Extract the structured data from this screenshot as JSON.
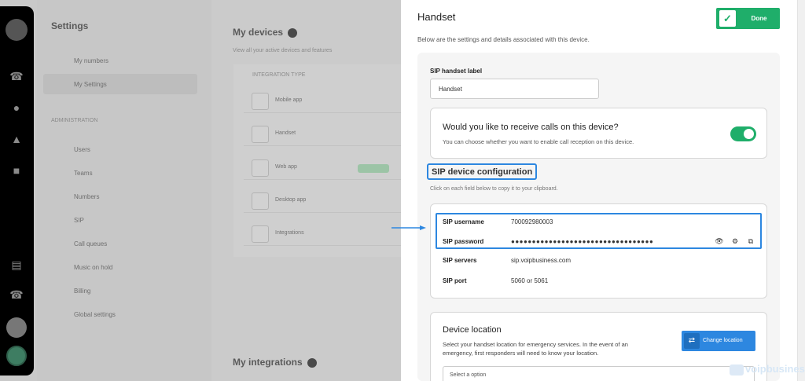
{
  "background": {
    "sidebar_title": "Settings",
    "nav_items": [
      "My numbers",
      "My Settings"
    ],
    "section_label": "ADMINISTRATION",
    "admin_items": [
      "Users",
      "Teams",
      "Numbers",
      "SIP",
      "Call queues",
      "Music on hold",
      "Billing",
      "Global settings"
    ],
    "devices_title": "My devices",
    "devices_sub": "View all your active devices and features",
    "devices_col": "INTEGRATION TYPE",
    "devices": [
      "Mobile app",
      "Handset",
      "Web app",
      "Desktop app",
      "Integrations"
    ],
    "integrations_title": "My integrations"
  },
  "drawer": {
    "title": "Handset",
    "done_label": "Done",
    "description": "Below are the settings and details associated with this device.",
    "label_field": {
      "label": "SIP handset label",
      "value": "Handset"
    },
    "receive_calls": {
      "question": "Would you like to receive calls on this device?",
      "description": "You can choose whether you want to enable call reception on this device.",
      "enabled": true
    },
    "config": {
      "title": "SIP device configuration",
      "hint": "Click on each field below to copy it to your clipboard.",
      "username_key": "SIP username",
      "username_value": "700092980003",
      "password_key": "SIP password",
      "password_value": "●●●●●●●●●●●●●●●●●●●●●●●●●●●●●●●●●●",
      "servers_key": "SIP servers",
      "servers_value": "sip.voipbusiness.com",
      "port_key": "SIP port",
      "port_value": "5060 or 5061"
    },
    "location": {
      "title": "Device location",
      "description": "Select your handset location for emergency services. In the event of an emergency, first responders will need to know your location.",
      "button_label": "Change location",
      "select_placeholder": "Select a option"
    }
  },
  "watermark": "voipbusiness",
  "colors": {
    "accent_green": "#1fae6a",
    "accent_blue": "#2d87e0"
  }
}
